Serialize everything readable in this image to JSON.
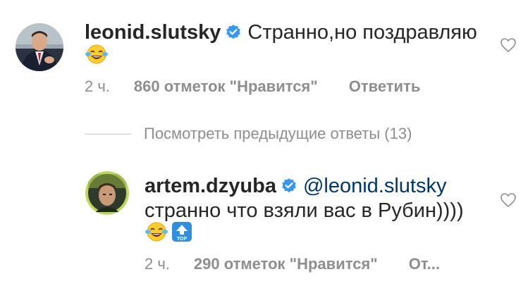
{
  "comments": [
    {
      "username": "leonid.slutsky",
      "text": "Странно,но поздравляю",
      "emojis": [
        "face-with-tears-of-joy"
      ],
      "time": "2 ч.",
      "likes": "860 отметок \"Нравится\"",
      "reply": "Ответить"
    }
  ],
  "view_previous": "Посмотреть предыдущие ответы (13)",
  "replies": [
    {
      "username": "artem.dzyuba",
      "mention": "@leonid.slutsky",
      "text": "странно что взяли вас в Рубин))))",
      "emojis": [
        "face-with-tears-of-joy",
        "top-arrow"
      ],
      "top_label": "TOP",
      "time": "2 ч.",
      "likes": "290 отметок \"Нравится\"",
      "reply": "От..."
    }
  ],
  "colors": {
    "text": "#262626",
    "meta": "#8e8e8e",
    "verified": "#3897f0",
    "mention": "#00376b"
  }
}
